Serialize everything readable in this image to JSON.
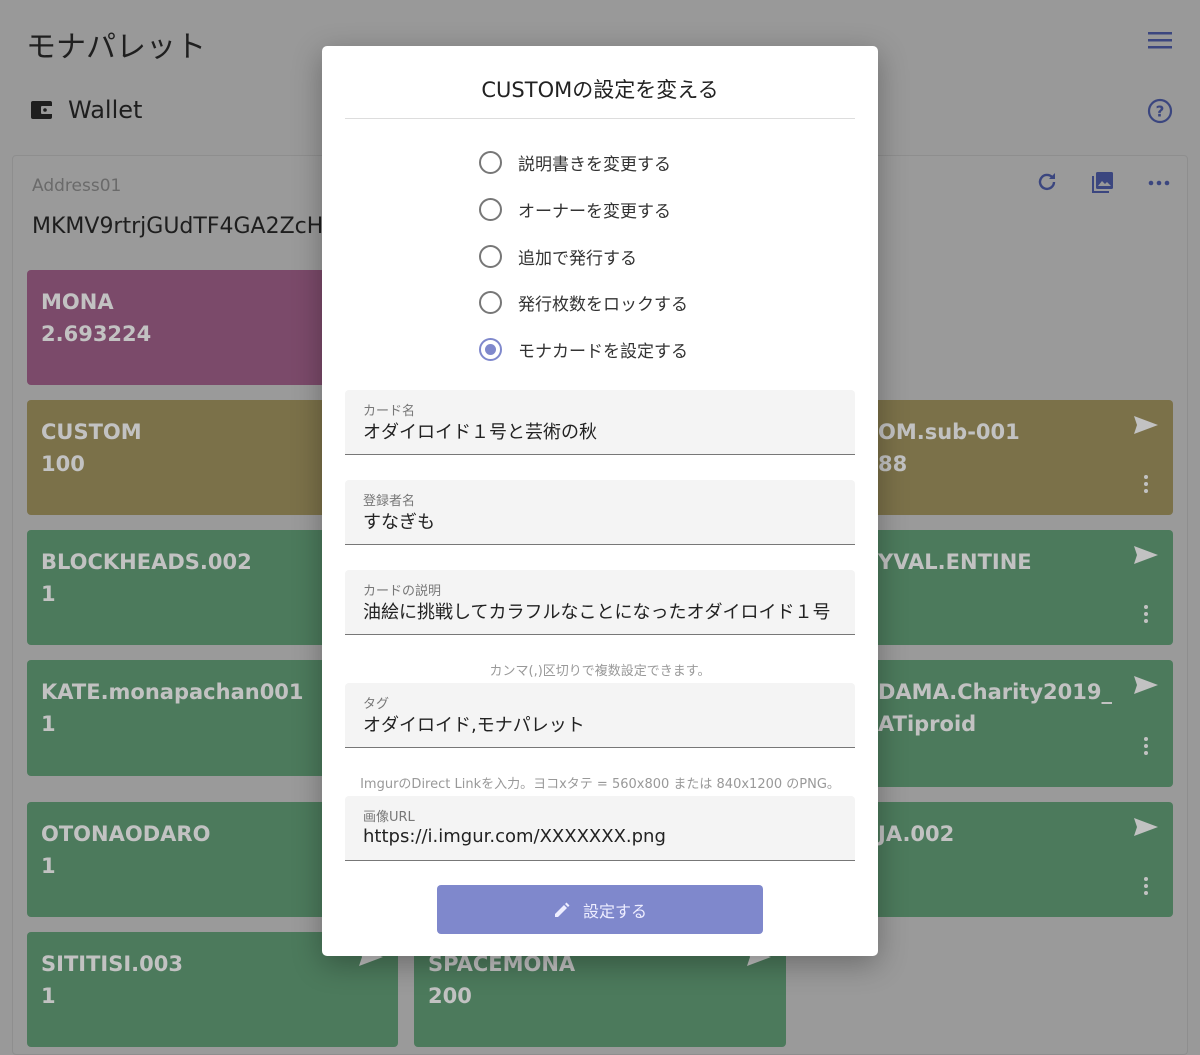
{
  "app": {
    "title": "モナパレット"
  },
  "wallet": {
    "label": "Wallet"
  },
  "address": {
    "label": "Address01",
    "value": "MKMV9rtrjGUdTF4GA2ZcH"
  },
  "colors": {
    "accent": "#7f88cc",
    "mona": "#7b4a6a",
    "custom": "#7b7149",
    "token": "#4c7a5c"
  },
  "cards": {
    "col1": [
      {
        "name": "MONA",
        "value": "2.693224"
      },
      {
        "name": "CUSTOM",
        "value": "100"
      },
      {
        "name": "BLOCKHEADS.002",
        "value": "1"
      },
      {
        "name": "KATE.monapachan001",
        "value": "1"
      },
      {
        "name": "OTONAODARO",
        "value": "1"
      },
      {
        "name": "SITITISI.003",
        "value": "1"
      }
    ],
    "col2": [
      {
        "name": "SPACEMONA",
        "value": "200"
      }
    ],
    "col3": [
      {
        "name": "OM.sub-001",
        "value": "88"
      },
      {
        "name": "YVAL.ENTINE",
        "value": ""
      },
      {
        "name": "DAMA.Charity2019_",
        "value": "ATiproid"
      },
      {
        "name": "JA.002",
        "value": ""
      }
    ]
  },
  "modal": {
    "title": "CUSTOMの設定を変える",
    "options": [
      {
        "label": "説明書きを変更する",
        "selected": false
      },
      {
        "label": "オーナーを変更する",
        "selected": false
      },
      {
        "label": "追加で発行する",
        "selected": false
      },
      {
        "label": "発行枚数をロックする",
        "selected": false
      },
      {
        "label": "モナカードを設定する",
        "selected": true
      }
    ],
    "fields": {
      "card_name": {
        "label": "カード名",
        "value": "オダイロイド１号と芸術の秋"
      },
      "owner": {
        "label": "登録者名",
        "value": "すなぎも"
      },
      "desc": {
        "label": "カードの説明",
        "value": "油絵に挑戦してカラフルなことになったオダイロイド１号"
      },
      "tags_hint": "カンマ(,)区切りで複数設定できます。",
      "tags": {
        "label": "タグ",
        "value": "オダイロイド,モナパレット"
      },
      "image_hint": "ImgurのDirect Linkを入力。ヨコxタテ = 560x800 または 840x1200 のPNG。",
      "image": {
        "label": "画像URL",
        "value": "https://i.imgur.com/XXXXXXX.png"
      }
    },
    "submit_label": "設定する"
  }
}
